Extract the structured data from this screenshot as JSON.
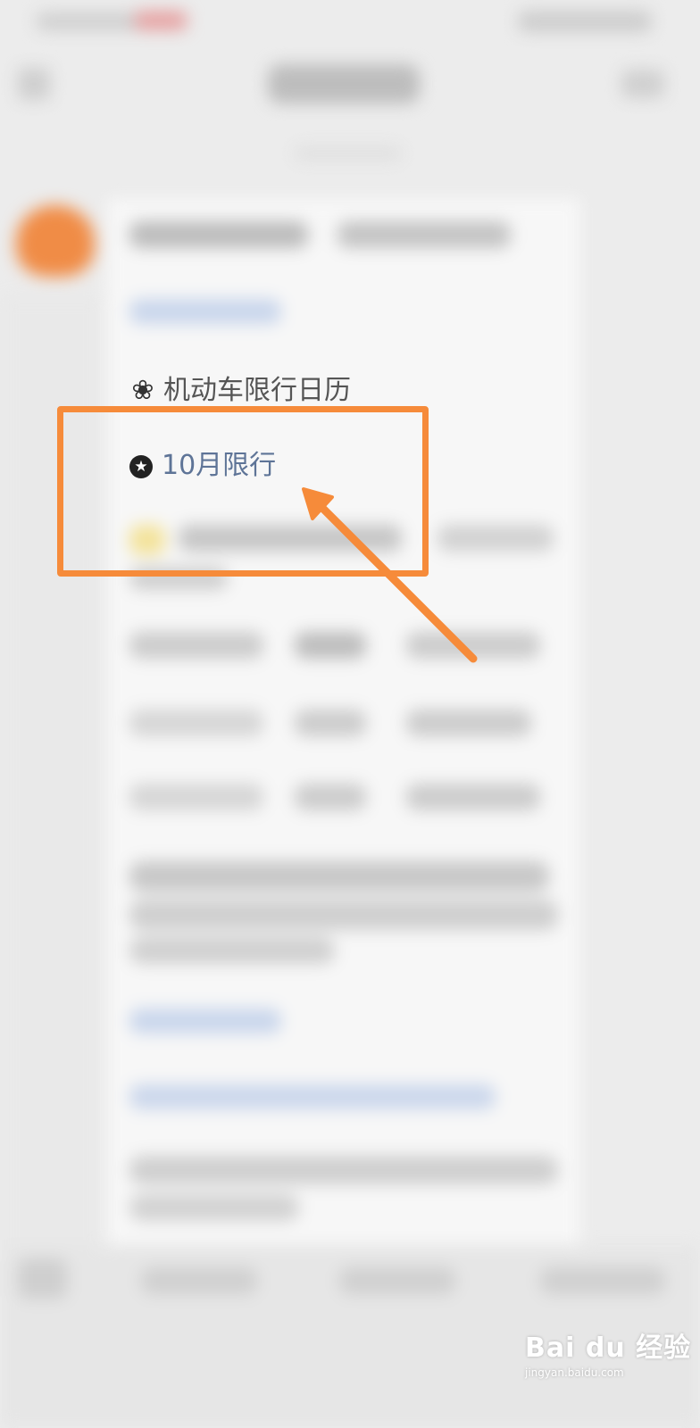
{
  "calendar": {
    "title": "机动车限行日历",
    "title_icon": "flower-icon",
    "highlighted_item": "10月限行",
    "highlighted_icon": "star-circle-icon"
  },
  "annotation": {
    "highlight_color": "#f68b3a"
  },
  "watermark": {
    "brand": "Bai du 经验",
    "url": "jingyan.baidu.com"
  }
}
